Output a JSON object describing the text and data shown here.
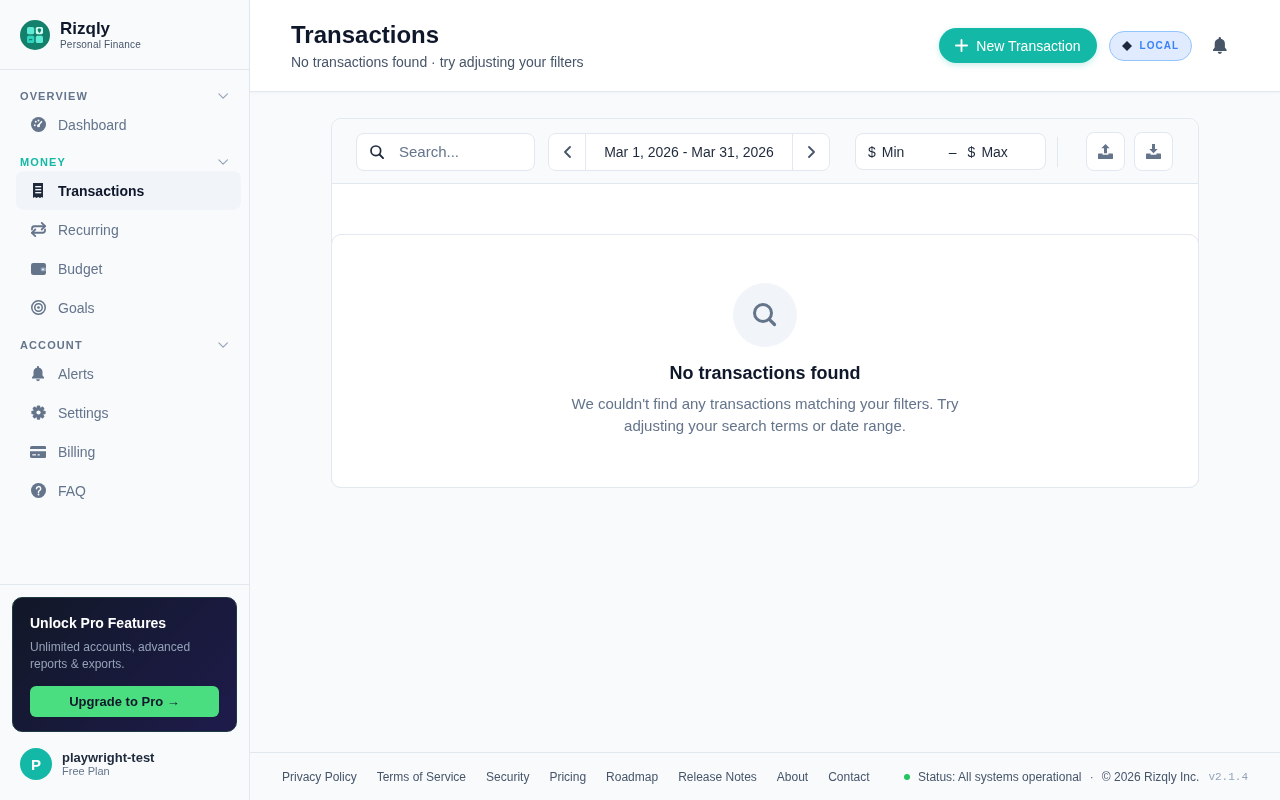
{
  "sidebar": {
    "brand": {
      "name": "Rizqly",
      "tagline": "Personal Finance"
    },
    "sections": [
      {
        "label": "OVERVIEW",
        "active": false,
        "expanded": true,
        "items": [
          {
            "label": "Dashboard",
            "selected": false
          }
        ]
      },
      {
        "label": "MONEY",
        "active": true,
        "expanded": true,
        "items": [
          {
            "label": "Transactions",
            "selected": true
          },
          {
            "label": "Recurring",
            "selected": false
          },
          {
            "label": "Budget",
            "selected": false
          },
          {
            "label": "Goals",
            "selected": false
          }
        ]
      },
      {
        "label": "ACCOUNT",
        "active": false,
        "expanded": true,
        "items": [
          {
            "label": "Alerts",
            "selected": false
          },
          {
            "label": "Settings",
            "selected": false
          },
          {
            "label": "Billing",
            "selected": false
          },
          {
            "label": "FAQ",
            "selected": false
          }
        ]
      }
    ],
    "promo": {
      "title": "Unlock Pro Features",
      "text": "Unlimited accounts, advanced reports & exports.",
      "button": "Upgrade to Pro →"
    },
    "user": {
      "initial": "P",
      "name": "playwright-test",
      "plan": "Free Plan"
    }
  },
  "header": {
    "title": "Transactions",
    "subtitle": "No transactions found · try adjusting your filters",
    "new_button": "New Transaction",
    "environment": "LOCAL"
  },
  "toolbar": {
    "search": {
      "placeholder": "Search..."
    },
    "date_range": "Mar 1, 2026 - Mar 31, 2026",
    "amount": {
      "min": {
        "currency": "$",
        "placeholder": "Min"
      },
      "separator": "–",
      "max": {
        "currency": "$",
        "placeholder": "Max"
      }
    }
  },
  "empty_state": {
    "title": "No transactions found",
    "text": "We couldn't find any transactions matching your filters. Try adjusting your search terms or date range."
  },
  "footer": {
    "links": [
      "Privacy Policy",
      "Terms of Service",
      "Security",
      "Pricing",
      "Roadmap",
      "Release Notes",
      "About",
      "Contact"
    ],
    "status": "Status: All systems operational",
    "separator": "·",
    "copyright": "© 2026 Rizqly Inc.",
    "version": "v2.1.4"
  }
}
